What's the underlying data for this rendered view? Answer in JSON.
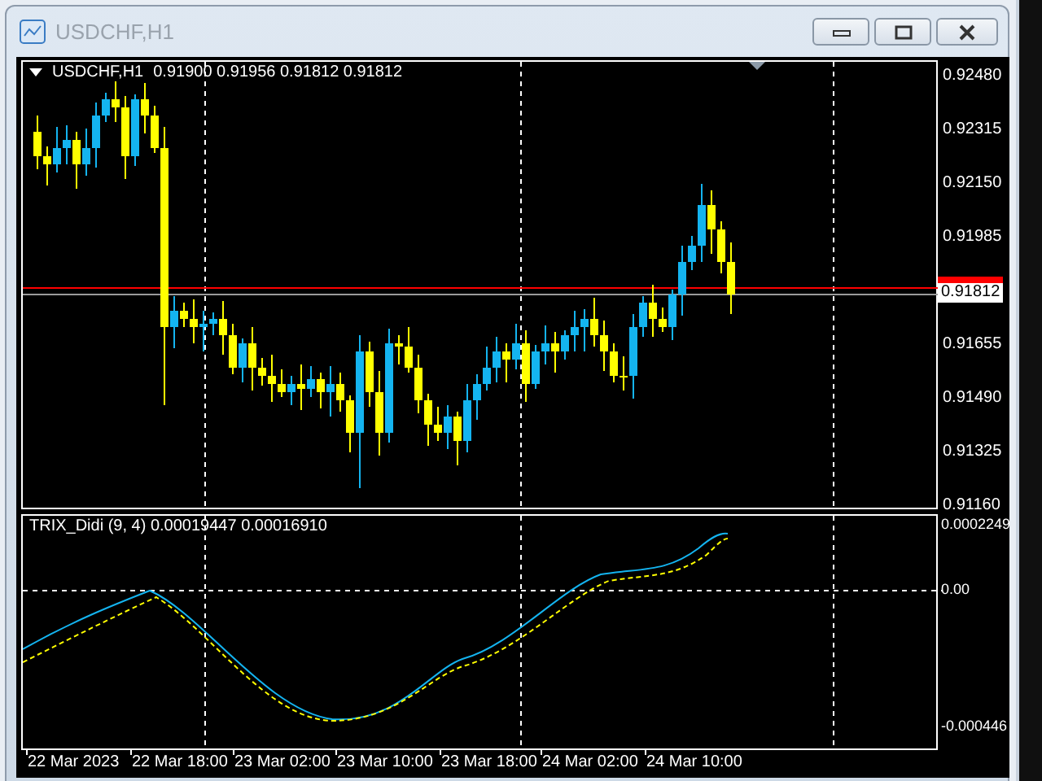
{
  "window": {
    "title": "USDCHF,H1"
  },
  "chart": {
    "symbol": "USDCHF,H1",
    "quotes": "0.91900 0.91956 0.91812 0.91812",
    "current_price": "0.91812",
    "price_axis": [
      "0.92480",
      "0.92315",
      "0.92150",
      "0.91985",
      "0.91655",
      "0.91490",
      "0.91325",
      "0.91160"
    ]
  },
  "indicator": {
    "label": "TRIX_Didi (9, 4) 0.00019447 0.00016910",
    "axis": [
      "0.0002249",
      "0.00",
      "-0.000446"
    ]
  },
  "time_axis": [
    "22 Mar 2023",
    "22 Mar 18:00",
    "23 Mar 02:00",
    "23 Mar 10:00",
    "23 Mar 18:00",
    "24 Mar 02:00",
    "24 Mar 10:00"
  ]
}
